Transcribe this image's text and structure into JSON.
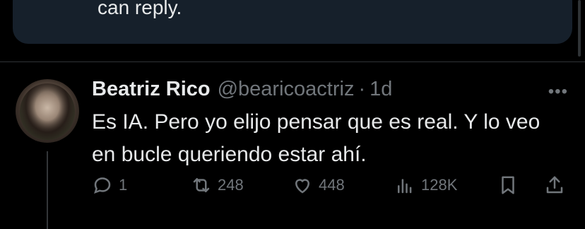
{
  "top_card": {
    "text": "can reply."
  },
  "tweet": {
    "name": "Beatriz Rico",
    "handle": "@bearicoactriz",
    "separator": "·",
    "time": "1d",
    "more": "•••",
    "text": "Es IA. Pero yo elijo pensar que es real. Y lo veo en bucle queriendo estar ahí."
  },
  "actions": {
    "replies": "1",
    "reposts": "248",
    "likes": "448",
    "views": "128K"
  },
  "colors": {
    "background": "#000000",
    "card": "#16202b",
    "text": "#e7e9ea",
    "muted": "#71767b",
    "divider": "#2f3336"
  }
}
